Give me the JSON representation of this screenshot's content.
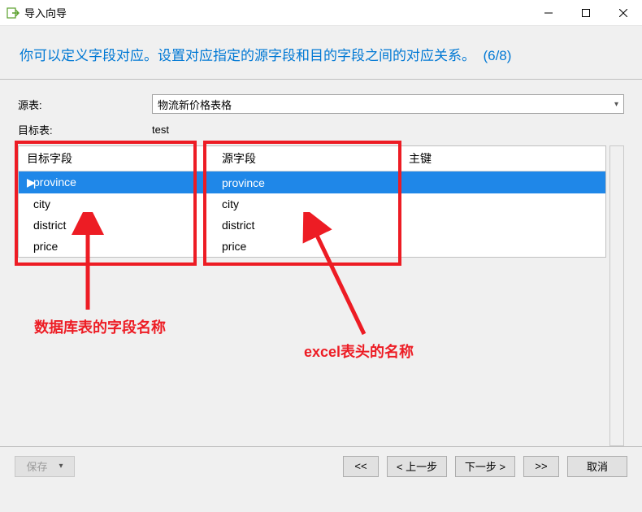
{
  "window": {
    "title": "导入向导"
  },
  "header": {
    "text": "你可以定义字段对应。设置对应指定的源字段和目的字段之间的对应关系。",
    "step": "(6/8)"
  },
  "form": {
    "source_table_label": "源表:",
    "source_table_value": "物流新价格表格",
    "target_table_label": "目标表:",
    "target_table_value": "test"
  },
  "grid": {
    "columns": {
      "target": "目标字段",
      "source": "源字段",
      "pk": "主键"
    },
    "rows": [
      {
        "target": "province",
        "source": "province",
        "selected": true
      },
      {
        "target": "city",
        "source": "city",
        "selected": false
      },
      {
        "target": "district",
        "source": "district",
        "selected": false
      },
      {
        "target": "price",
        "source": "price",
        "selected": false
      }
    ]
  },
  "annotations": {
    "left_label": "数据库表的字段名称",
    "right_label": "excel表头的名称"
  },
  "buttons": {
    "save": "保存",
    "first": "<<",
    "prev": "< 上一步",
    "next": "下一步 >",
    "last": ">>",
    "cancel": "取消"
  }
}
